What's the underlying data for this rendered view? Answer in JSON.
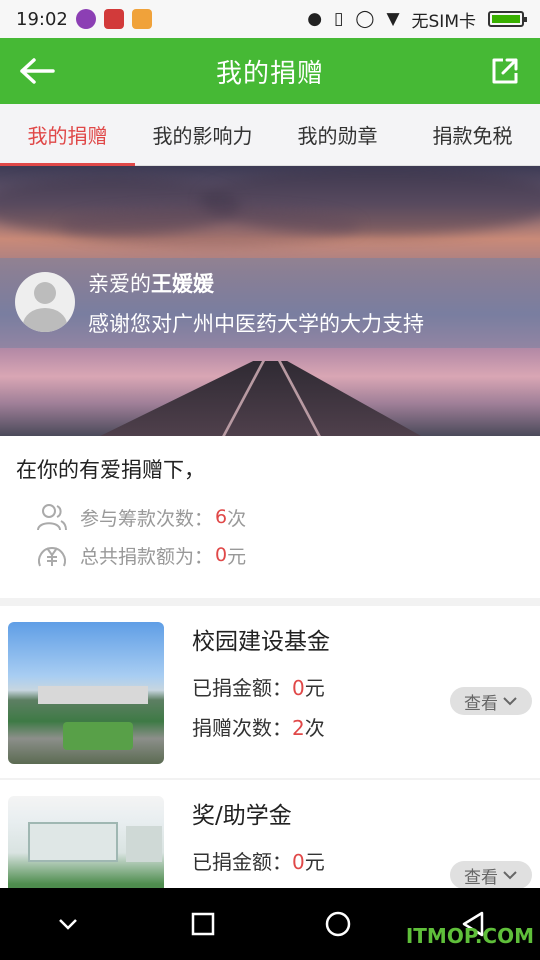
{
  "status_bar": {
    "time": "19:02",
    "carrier": "无SIM卡"
  },
  "header": {
    "title": "我的捐赠"
  },
  "tabs": [
    {
      "label": "我的捐赠",
      "active": true
    },
    {
      "label": "我的影响力",
      "active": false
    },
    {
      "label": "我的勋章",
      "active": false
    },
    {
      "label": "捐款免税",
      "active": false
    }
  ],
  "welcome": {
    "greeting_prefix": "亲爱的",
    "user_name": "王媛媛",
    "message": "感谢您对广州中医药大学的大力支持"
  },
  "summary": {
    "heading": "在你的有爱捐赠下，",
    "count_label": "参与筹款次数：",
    "count_value": "6",
    "count_unit": "次",
    "total_label": "总共捐款额为：",
    "total_value": "0",
    "total_unit": "元"
  },
  "funds": [
    {
      "name": "校园建设基金",
      "amount_label": "已捐金额：",
      "amount_value": "0",
      "amount_unit": "元",
      "times_label": "捐赠次数：",
      "times_value": "2",
      "times_unit": "次",
      "view_label": "查看"
    },
    {
      "name": "奖/助学金",
      "amount_label": "已捐金额：",
      "amount_value": "0",
      "amount_unit": "元",
      "view_label": "查看"
    }
  ],
  "watermark": "ITMOP.COM",
  "colors": {
    "brand_green": "#46b935",
    "accent_red": "#e04848"
  }
}
